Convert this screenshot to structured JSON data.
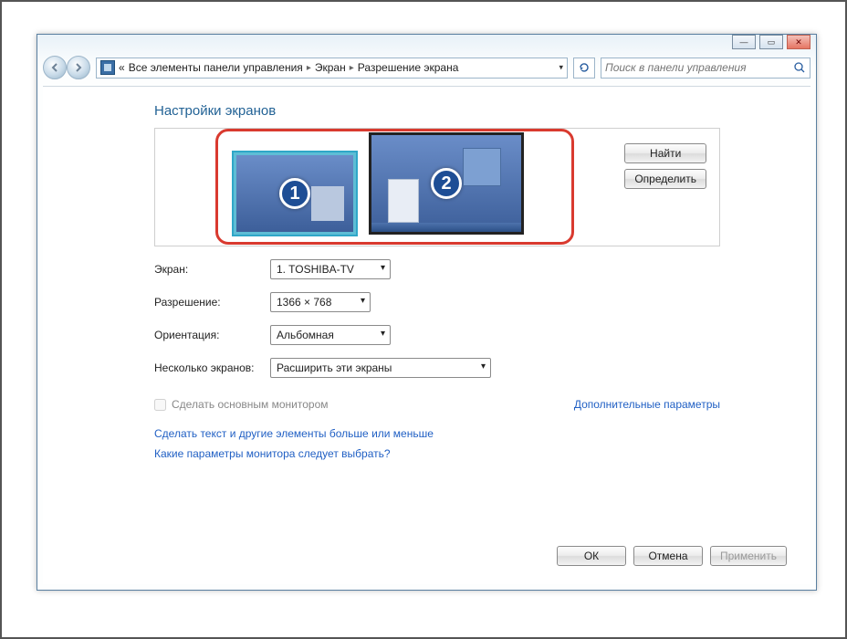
{
  "window_controls": {
    "minimize": "—",
    "maximize": "▭",
    "close": "✕"
  },
  "breadcrumb": {
    "prefix": "«",
    "items": [
      "Все элементы панели управления",
      "Экран",
      "Разрешение экрана"
    ]
  },
  "search": {
    "placeholder": "Поиск в панели управления"
  },
  "heading": "Настройки экранов",
  "monitors": [
    {
      "id": 1,
      "label": "1",
      "selected": true
    },
    {
      "id": 2,
      "label": "2",
      "selected": false
    }
  ],
  "side_buttons": {
    "find": "Найти",
    "identify": "Определить"
  },
  "fields": {
    "display": {
      "label": "Экран:",
      "value": "1. TOSHIBA-TV"
    },
    "resolution": {
      "label": "Разрешение:",
      "value": "1366 × 768"
    },
    "orientation": {
      "label": "Ориентация:",
      "value": "Альбомная"
    },
    "multi": {
      "label": "Несколько экранов:",
      "value": "Расширить эти экраны"
    }
  },
  "make_primary": {
    "label": "Сделать основным монитором",
    "checked": false,
    "enabled": false
  },
  "advanced_link": "Дополнительные параметры",
  "help_links": [
    "Сделать текст и другие элементы больше или меньше",
    "Какие параметры монитора следует выбрать?"
  ],
  "footer": {
    "ok": "ОК",
    "cancel": "Отмена",
    "apply": "Применить"
  }
}
